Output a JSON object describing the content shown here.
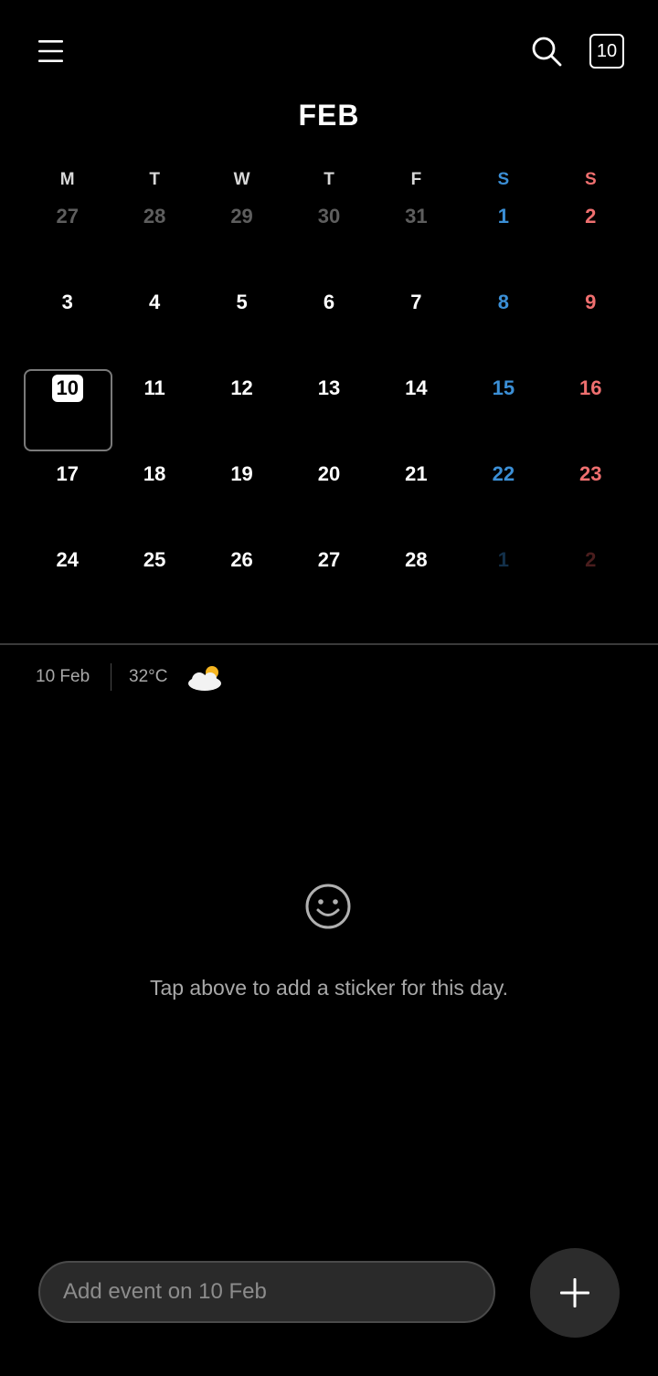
{
  "header": {
    "menu_icon": "hamburger-menu-icon",
    "search_icon": "search-icon",
    "today_label": "10",
    "month": "FEB"
  },
  "weekdays": [
    "M",
    "T",
    "W",
    "T",
    "F",
    "S",
    "S"
  ],
  "weekday_colors": {
    "default": "#d8d8d8",
    "saturday": "#3b8fd6",
    "sunday": "#ef6f6f"
  },
  "weeks": [
    [
      "27",
      "28",
      "29",
      "30",
      "31",
      "1",
      "2"
    ],
    [
      "3",
      "4",
      "5",
      "6",
      "7",
      "8",
      "9"
    ],
    [
      "10",
      "11",
      "12",
      "13",
      "14",
      "15",
      "16"
    ],
    [
      "17",
      "18",
      "19",
      "20",
      "21",
      "22",
      "23"
    ],
    [
      "24",
      "25",
      "26",
      "27",
      "28",
      "1",
      "2"
    ]
  ],
  "selected_day": "10",
  "info": {
    "date": "10 Feb",
    "temperature": "32°C",
    "weather_icon": "partly-cloudy-icon"
  },
  "sticker": {
    "icon": "smiley-icon",
    "hint": "Tap above to add a sticker for this day."
  },
  "add_event": {
    "placeholder": "Add event on 10 Feb",
    "fab_icon": "plus-icon"
  }
}
